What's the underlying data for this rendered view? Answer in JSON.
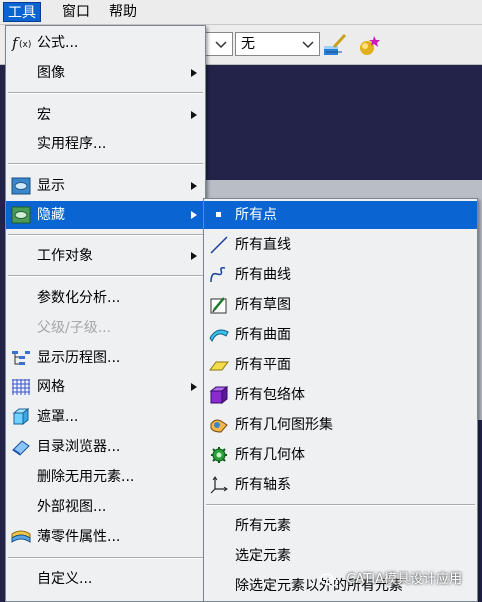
{
  "menubar": {
    "items": [
      "工具",
      "窗口",
      "帮助"
    ]
  },
  "toolbar": {
    "combo_value": "无"
  },
  "tools_menu": {
    "items": [
      {
        "name": "formula",
        "label": "公式..."
      },
      {
        "name": "image",
        "label": "图像"
      },
      {
        "name": "macro",
        "label": "宏"
      },
      {
        "name": "utility",
        "label": "实用程序..."
      },
      {
        "name": "show",
        "label": "显示"
      },
      {
        "name": "hide",
        "label": "隐藏"
      },
      {
        "name": "work-object",
        "label": "工作对象"
      },
      {
        "name": "parameterization-analysis",
        "label": "参数化分析..."
      },
      {
        "name": "parent-child",
        "label": "父级/子级..."
      },
      {
        "name": "show-history",
        "label": "显示历程图..."
      },
      {
        "name": "grid",
        "label": "网格"
      },
      {
        "name": "mask",
        "label": "遮罩..."
      },
      {
        "name": "catalog-browser",
        "label": "目录浏览器..."
      },
      {
        "name": "delete-unused",
        "label": "删除无用元素..."
      },
      {
        "name": "external-view",
        "label": "外部视图..."
      },
      {
        "name": "sheet-metal-props",
        "label": "薄零件属性..."
      },
      {
        "name": "customize",
        "label": "自定义..."
      }
    ]
  },
  "hide_submenu": {
    "items": [
      {
        "name": "all-points",
        "label": "所有点"
      },
      {
        "name": "all-lines",
        "label": "所有直线"
      },
      {
        "name": "all-curves",
        "label": "所有曲线"
      },
      {
        "name": "all-sketches",
        "label": "所有草图"
      },
      {
        "name": "all-surfaces",
        "label": "所有曲面"
      },
      {
        "name": "all-planes",
        "label": "所有平面"
      },
      {
        "name": "all-bodies",
        "label": "所有包络体"
      },
      {
        "name": "all-geometric-sets",
        "label": "所有几何图形集"
      },
      {
        "name": "all-geometric-bodies",
        "label": "所有几何体"
      },
      {
        "name": "all-axis-systems",
        "label": "所有轴系"
      },
      {
        "name": "all-elements",
        "label": "所有元素"
      },
      {
        "name": "selected-elements",
        "label": "选定元素"
      },
      {
        "name": "except-selected",
        "label": "除选定元素以外的所有元素"
      }
    ]
  },
  "watermark": "CATIA模具设计应用",
  "colors": {
    "highlight": "#0a64d2",
    "menu_bg": "#eef0f2",
    "workspace": "#23234a"
  }
}
